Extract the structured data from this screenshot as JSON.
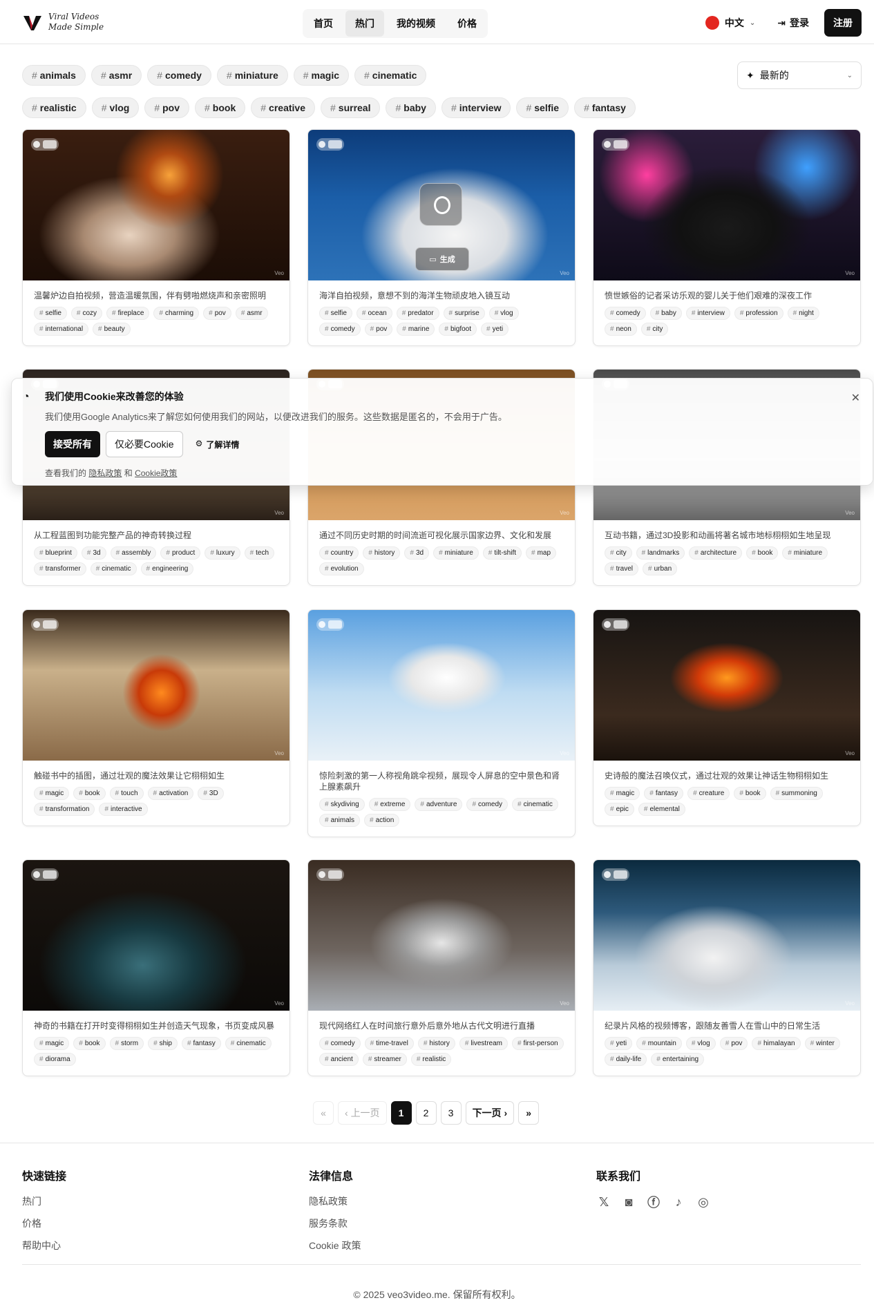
{
  "header": {
    "logo_line1": "Viral Videos",
    "logo_line2": "Made Simple",
    "nav": [
      "首页",
      "热门",
      "我的视频",
      "价格"
    ],
    "active_nav": "热门",
    "language": "中文",
    "login": "登录",
    "signup": "注册"
  },
  "filters": {
    "row1": [
      "animals",
      "asmr",
      "comedy",
      "miniature",
      "magic",
      "cinematic"
    ],
    "row2": [
      "realistic",
      "vlog",
      "pov",
      "book",
      "creative",
      "surreal",
      "baby",
      "interview",
      "selfie",
      "fantasy"
    ],
    "sort_label": "最新的"
  },
  "cards": [
    {
      "title": "温馨炉边自拍视频，营造温暖氛围，伴有劈啪燃烧声和亲密照明",
      "tags": [
        "selfie",
        "cozy",
        "fireplace",
        "charming",
        "pov",
        "asmr",
        "international",
        "beauty"
      ]
    },
    {
      "title": "海洋自拍视频，意想不到的海洋生物顽皮地入镜互动",
      "tags": [
        "selfie",
        "ocean",
        "predator",
        "surprise",
        "vlog",
        "comedy",
        "pov",
        "marine",
        "bigfoot",
        "yeti"
      ],
      "generate_label": "生成"
    },
    {
      "title": "愤世嫉俗的记者采访乐观的婴儿关于他们艰难的深夜工作",
      "tags": [
        "comedy",
        "baby",
        "interview",
        "profession",
        "night",
        "neon",
        "city"
      ]
    },
    {
      "title": "从工程蓝图到功能完整产品的神奇转换过程",
      "tags": [
        "blueprint",
        "3d",
        "assembly",
        "product",
        "luxury",
        "tech",
        "transformer",
        "cinematic",
        "engineering"
      ]
    },
    {
      "title": "通过不同历史时期的时间流逝可视化展示国家边界、文化和发展",
      "tags": [
        "country",
        "history",
        "3d",
        "miniature",
        "tilt-shift",
        "map",
        "evolution"
      ]
    },
    {
      "title": "互动书籍，通过3D投影和动画将著名城市地标栩栩如生地呈现",
      "tags": [
        "city",
        "landmarks",
        "architecture",
        "book",
        "miniature",
        "travel",
        "urban"
      ]
    },
    {
      "title": "触碰书中的插图，通过壮观的魔法效果让它栩栩如生",
      "tags": [
        "magic",
        "book",
        "touch",
        "activation",
        "3D",
        "transformation",
        "interactive"
      ]
    },
    {
      "title": "惊险刺激的第一人称视角跳伞视频，展现令人屏息的空中景色和肾上腺素飙升",
      "tags": [
        "skydiving",
        "extreme",
        "adventure",
        "comedy",
        "cinematic",
        "animals",
        "action"
      ]
    },
    {
      "title": "史诗般的魔法召唤仪式，通过壮观的效果让神话生物栩栩如生",
      "tags": [
        "magic",
        "fantasy",
        "creature",
        "book",
        "summoning",
        "epic",
        "elemental"
      ]
    },
    {
      "title": "神奇的书籍在打开时变得栩栩如生并创造天气现象，书页变成风暴",
      "tags": [
        "magic",
        "book",
        "storm",
        "ship",
        "fantasy",
        "cinematic",
        "diorama"
      ]
    },
    {
      "title": "现代网络红人在时间旅行意外后意外地从古代文明进行直播",
      "tags": [
        "comedy",
        "time-travel",
        "history",
        "livestream",
        "first-person",
        "ancient",
        "streamer",
        "realistic"
      ]
    },
    {
      "title": "纪录片风格的视频博客，跟随友善雪人在雪山中的日常生活",
      "tags": [
        "yeti",
        "mountain",
        "vlog",
        "pov",
        "himalayan",
        "winter",
        "daily-life",
        "entertaining"
      ]
    }
  ],
  "cookie": {
    "title": "我们使用Cookie来改善您的体验",
    "text": "我们使用Google Analytics来了解您如何使用我们的网站，以便改进我们的服务。这些数据是匿名的，不会用于广告。",
    "accept": "接受所有",
    "necessary": "仅必要Cookie",
    "details": "了解详情",
    "foot_prefix": "查看我们的",
    "privacy": "隐私政策",
    "and": "和",
    "cookie_policy": "Cookie政策"
  },
  "pagination": {
    "prev": "上一页",
    "next": "下一页",
    "pages": [
      "1",
      "2",
      "3"
    ],
    "current": "1"
  },
  "footer": {
    "quick_title": "快速链接",
    "quick_links": [
      "热门",
      "价格",
      "帮助中心"
    ],
    "legal_title": "法律信息",
    "legal_links": [
      "隐私政策",
      "服务条款",
      "Cookie 政策"
    ],
    "contact_title": "联系我们",
    "social_icons": [
      "x-icon",
      "discord-icon",
      "facebook-icon",
      "tiktok-icon",
      "instagram-icon"
    ],
    "copyright": "© 2025 veo3video.me. 保留所有权利。"
  }
}
